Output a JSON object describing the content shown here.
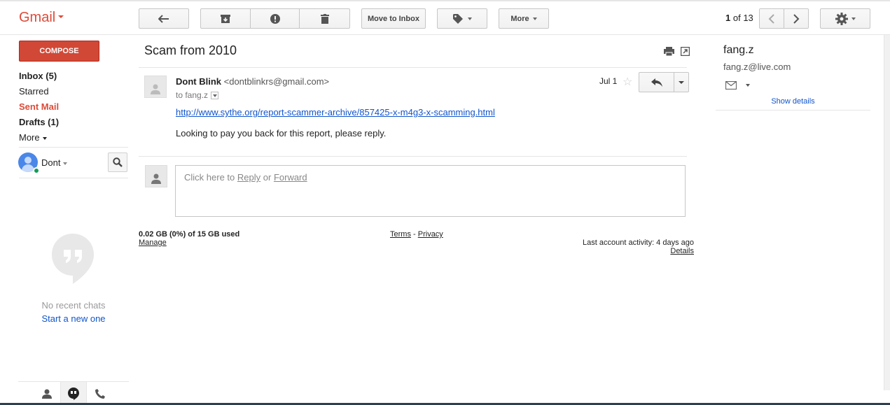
{
  "app": {
    "logo": "Gmail"
  },
  "toolbar": {
    "move_to_inbox": "Move to Inbox",
    "more": "More"
  },
  "pager": {
    "current": "1",
    "of": "of",
    "total": "13"
  },
  "sidebar": {
    "compose": "COMPOSE",
    "items": [
      {
        "label": "Inbox (5)"
      },
      {
        "label": "Starred"
      },
      {
        "label": "Sent Mail"
      },
      {
        "label": "Drafts (1)"
      },
      {
        "label": "More"
      }
    ],
    "user": "Dont",
    "no_recent_chats": "No recent chats",
    "start_new": "Start a new one"
  },
  "message": {
    "subject": "Scam from 2010",
    "sender_name": "Dont Blink",
    "sender_email": "<dontblinkrs@gmail.com>",
    "to": "to fang.z",
    "date": "Jul 1",
    "link": "http://www.sythe.org/report-scammer-archive/857425-x-m4g3-x-scamming.html",
    "body": "Looking to pay you back for this report, please reply."
  },
  "reply_box": {
    "prefix": "Click here to",
    "reply": "Reply",
    "or": "or",
    "forward": "Forward"
  },
  "footer": {
    "storage": "0.02 GB (0%) of 15 GB used",
    "manage": "Manage",
    "terms": "Terms",
    "dash": "-",
    "privacy": "Privacy",
    "activity": "Last account activity: 4 days ago",
    "details": "Details"
  },
  "contact": {
    "name": "fang.z",
    "email": "fang.z@live.com",
    "show_details": "Show details"
  },
  "colors": {
    "brand_red": "#dd4b39",
    "compose_red": "#d14836",
    "link_blue": "#1155cc",
    "online_green": "#0f9d58"
  }
}
